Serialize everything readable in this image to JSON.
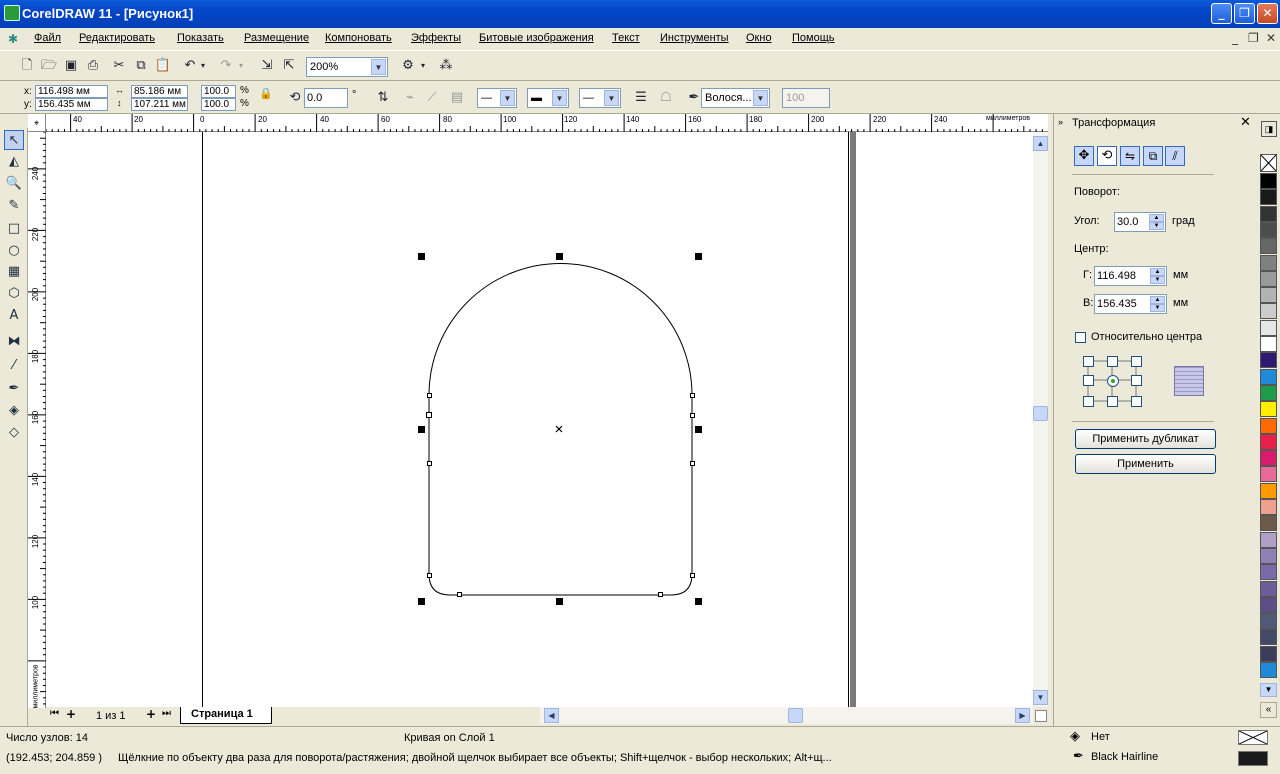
{
  "window": {
    "title": "CorelDRAW 11 - [Рисунок1]",
    "minimize": "_",
    "maximize": "❐",
    "close": "✕"
  },
  "menu": [
    "Файл",
    "Редактировать",
    "Показать",
    "Размещение",
    "Компоновать",
    "Эффекты",
    "Битовые изображения",
    "Текст",
    "Инструменты",
    "Окно",
    "Помощь"
  ],
  "mdi_controls": {
    "minimize": "_",
    "restore": "❐",
    "close": "✕"
  },
  "toolbar": {
    "zoom": "200%"
  },
  "propbar": {
    "x_label": "x:",
    "x_value": "116.498 мм",
    "y_label": "y:",
    "y_value": "156.435 мм",
    "width_value": "85.186 мм",
    "height_value": "107.211 мм",
    "scale_w": "100.0",
    "scale_h": "100.0",
    "percent": "%",
    "angle_value": "0.0",
    "degree": "°",
    "outline_width": "Волосяная",
    "outline_width_display": "Волося...",
    "transparency_value": "100"
  },
  "rulers": {
    "units": "миллиметров",
    "h_ticks": [
      "40",
      "20",
      "0",
      "20",
      "40",
      "60",
      "80",
      "100",
      "120",
      "140",
      "160",
      "180",
      "200",
      "220",
      "240"
    ],
    "v_ticks": [
      "240",
      "220",
      "200",
      "180",
      "160",
      "140",
      "120",
      "100"
    ],
    "v_units": "миллиметров"
  },
  "pages": {
    "count_text": "1 из 1",
    "tab": "Страница 1"
  },
  "docker": {
    "title": "Трансформация",
    "section_rotate": "Поворот:",
    "angle_label": "Угол:",
    "angle_value": "30.0",
    "angle_unit": "град",
    "center_label": "Центр:",
    "h_label": "Г:",
    "h_value": "116.498",
    "h_unit": "мм",
    "v_label": "В:",
    "v_value": "156.435",
    "v_unit": "мм",
    "relative_label": "Относительно центра",
    "apply_duplicate": "Применить дубликат",
    "apply": "Применить"
  },
  "palette_colors": [
    "#000000",
    "#1a1a1a",
    "#333333",
    "#4d4d4d",
    "#666666",
    "#808080",
    "#999999",
    "#b3b3b3",
    "#cccccc",
    "#e6e6e6",
    "#ffffff",
    "#2e1a6e",
    "#1f8ad8",
    "#1e9a48",
    "#ffee00",
    "#ff6a00",
    "#e8204a",
    "#d81b6a",
    "#e86a9a",
    "#ff9a00",
    "#f0a090",
    "#6b5a4a",
    "#b0a0c8",
    "#9080b8",
    "#7a6aa8",
    "#6c5c98",
    "#5e4e88",
    "#505a78",
    "#424a68",
    "#3c3c5c",
    "#1f8ad8"
  ],
  "status": {
    "nodes": "Число узлов: 14",
    "object": "Кривая on Слой 1",
    "coords": "(192.453; 204.859 )",
    "hint": "Щёлкние по объекту два раза для поворота/растяжения; двойной щелчок выбирает все объекты; Shift+щелчок - выбор нескольких; Alt+щ...",
    "fill_label": "Нет",
    "outline_label": "Black  Hairline"
  }
}
